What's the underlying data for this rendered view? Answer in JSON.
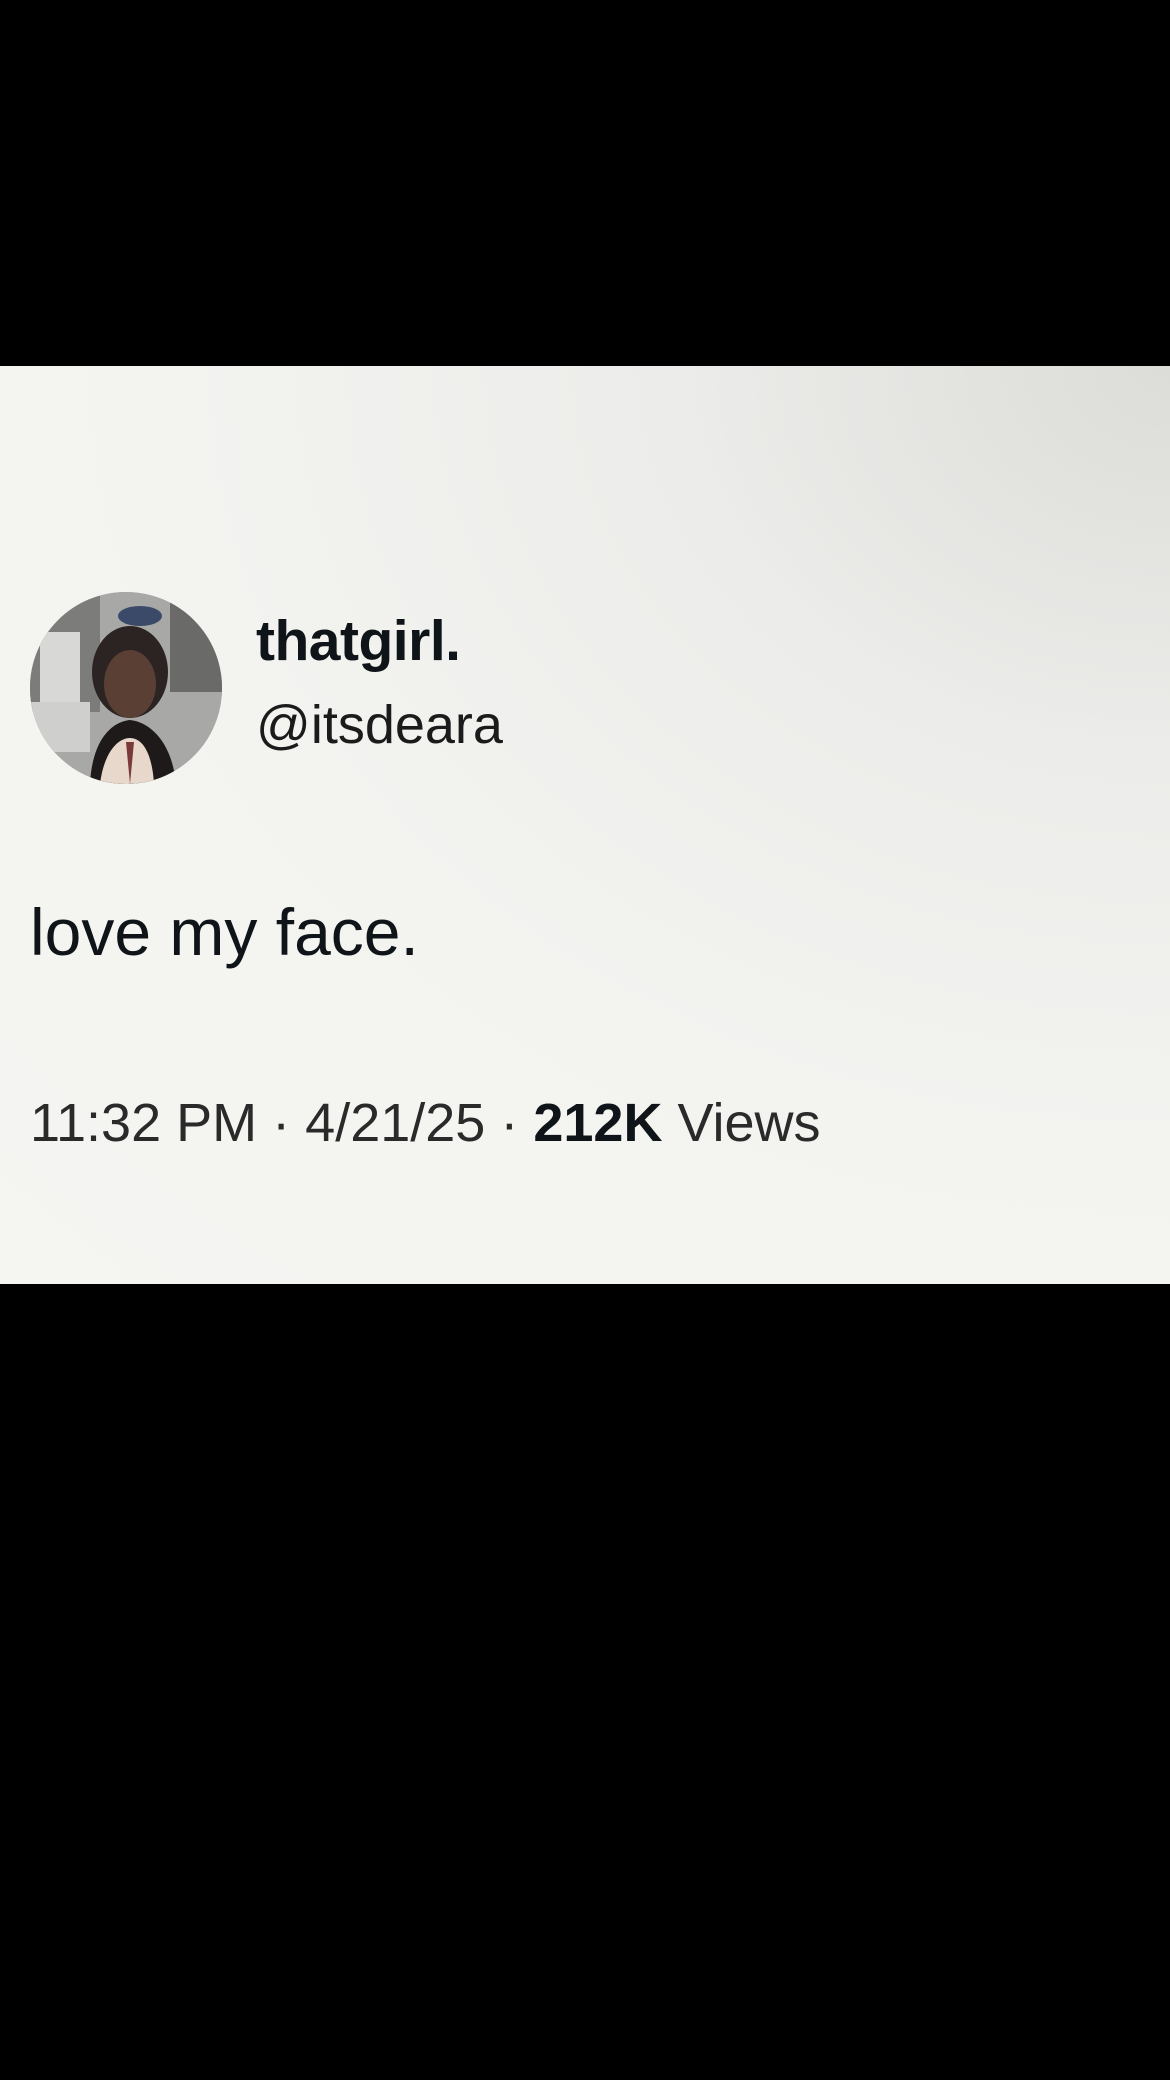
{
  "tweet": {
    "display_name": "thatgirl.",
    "handle": "@itsdeara",
    "text": "love my face.",
    "time": "11:32 PM",
    "separator": "·",
    "date": "4/21/25",
    "views_count": "212K",
    "views_label": "Views"
  },
  "colors": {
    "letterbox": "#000000",
    "card_background": "#f5f5f2",
    "text_primary": "#0f1419"
  },
  "icons": {
    "avatar": "profile-photo"
  }
}
